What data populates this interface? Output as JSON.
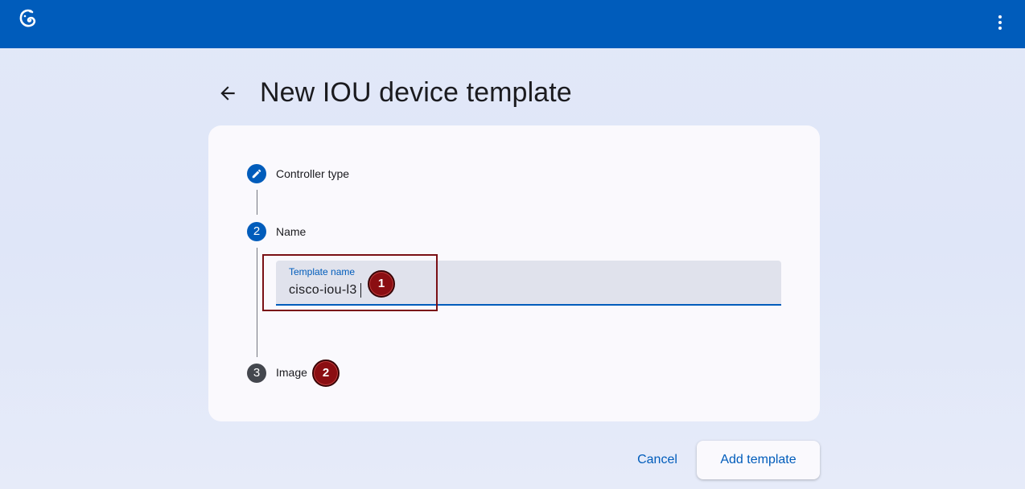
{
  "header": {
    "logo_icon": "gns3-logo-icon",
    "menu_icon": "more-vert-icon",
    "background_color": "#005cbb"
  },
  "page": {
    "title": "New IOU device template",
    "back_icon": "arrow-back-icon"
  },
  "stepper": {
    "steps": [
      {
        "number": "",
        "icon": "edit-pencil-icon",
        "label": "Controller type",
        "state": "edited"
      },
      {
        "number": "2",
        "label": "Name",
        "state": "active"
      },
      {
        "number": "3",
        "label": "Image",
        "state": "pending"
      }
    ]
  },
  "name_field": {
    "label": "Template name",
    "value": "cisco-iou-l3"
  },
  "annotations": [
    {
      "label": "1"
    },
    {
      "label": "2"
    }
  ],
  "actions": {
    "cancel_label": "Cancel",
    "add_label": "Add template"
  },
  "colors": {
    "primary": "#005cbb",
    "annotation": "#8b0e12"
  }
}
